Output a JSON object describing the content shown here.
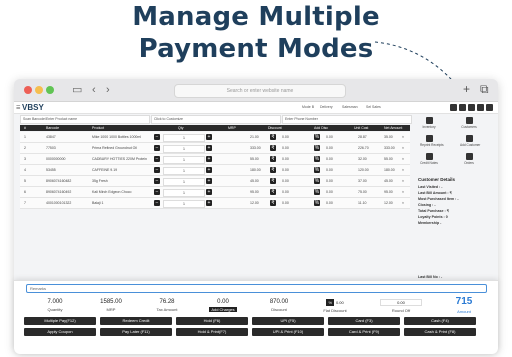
{
  "headline": {
    "line1": "Manage Multiple",
    "line2": "Payment Modes"
  },
  "browser": {
    "url_placeholder": "Search or enter website name",
    "back": "‹",
    "forward": "›",
    "new_tab": "+",
    "tabs_icon": "⧉"
  },
  "app": {
    "logo": "VBSY",
    "mode": "Mode B",
    "delivery": "Delivery",
    "salesman": "Salesman",
    "sel_sales": "Sel Sales"
  },
  "search": {
    "product": "Scan Barcode/Enter Product name",
    "customer": "Click to Customize",
    "phone": "Enter Phone Number"
  },
  "table": {
    "headers": [
      "#",
      "Barcode",
      "Product",
      "Qty",
      "MRP",
      "Discount",
      "Add Disc",
      "Unit Cost",
      "Net Amount"
    ],
    "rows": [
      {
        "n": "1",
        "barcode": "43847",
        "product": "Mike 1000 1000 Bottles 1000ml",
        "qty": "1",
        "mrp": "21.00",
        "disc": "0.00",
        "adisc": "0.00",
        "unit": "28.87",
        "net": "35.00"
      },
      {
        "n": "2",
        "barcode": "77503",
        "product": "Prima Refined Groundnut Oil",
        "qty": "1",
        "mrp": "333.00",
        "disc": "0.00",
        "adisc": "0.00",
        "unit": "226.70",
        "net": "333.00"
      },
      {
        "n": "3",
        "barcode": "0000000000",
        "product": "CADBURY HOTTIES 220M Protein",
        "qty": "1",
        "mrp": "55.00",
        "disc": "0.00",
        "adisc": "0.00",
        "unit": "32.00",
        "net": "55.00"
      },
      {
        "n": "4",
        "barcode": "53455",
        "product": "CAFFEINE 9.19",
        "qty": "1",
        "mrp": "180.00",
        "disc": "0.00",
        "adisc": "0.00",
        "unit": "120.00",
        "net": "180.00"
      },
      {
        "n": "5",
        "barcode": "8906074160482",
        "product": "35g Fresh",
        "qty": "1",
        "mrp": "45.00",
        "disc": "0.00",
        "adisc": "0.00",
        "unit": "37.00",
        "net": "45.00"
      },
      {
        "n": "6",
        "barcode": "8906074160492",
        "product": "Kali Mirch Edgeon Choco",
        "qty": "1",
        "mrp": "95.00",
        "disc": "0.00",
        "adisc": "0.00",
        "unit": "75.00",
        "net": "95.00"
      },
      {
        "n": "7",
        "barcode": "4001000101322",
        "product": "Balaji 1",
        "qty": "1",
        "mrp": "12.00",
        "disc": "0.00",
        "adisc": "0.00",
        "unit": "11.10",
        "net": "12.00"
      }
    ]
  },
  "sidebar": {
    "icons": [
      "Inventory",
      "Customers",
      "Reprint Receipts",
      "Add Customer",
      "Credit Notes",
      "Orders"
    ],
    "customer_title": "Customer Details",
    "fields": [
      "Last Visited : -",
      "Last Bill Amount : ₹",
      "Most Purchased Item : -",
      "Closing : -",
      "Total Purchase : ₹",
      "Loyalty Points : 0",
      "Membership -"
    ],
    "last_bill_no": "Last Bill No : -",
    "last_bill_amount": "Last Bill Amount : -",
    "add_bill": "Add Bill Party"
  },
  "bottom": {
    "remarks": "Remarks",
    "quantity": {
      "value": "7.000",
      "label": "Quantity"
    },
    "mrp": {
      "value": "1585.00",
      "label": "MRP"
    },
    "tax": {
      "value": "76.28",
      "label": "Tax Amount"
    },
    "charges": {
      "value": "0.00",
      "label": "Add Charges"
    },
    "discount": {
      "value": "870.00",
      "label": "Discount"
    },
    "flat": {
      "value": "0.00",
      "label": "Flat Discount"
    },
    "round": {
      "value": "0.00",
      "label": "Round Off"
    },
    "amount": {
      "value": "715",
      "label": "Amount"
    },
    "row1": [
      "Multiple Pay(F12)",
      "Redeem Credit",
      "Hold (F6)",
      "UPI (F5)",
      "Card (F3)",
      "Cash (F4)"
    ],
    "row2": [
      "Apply Coupon",
      "Pay Later (F11)",
      "Hold & Print(F7)",
      "UPI & Print (F10)",
      "Card & Print (F9)",
      "Cash & Print (F8)"
    ]
  },
  "colors": {
    "accent": "#2b7bd4",
    "dark": "#1f3f5c",
    "button": "#2a2a2a"
  }
}
